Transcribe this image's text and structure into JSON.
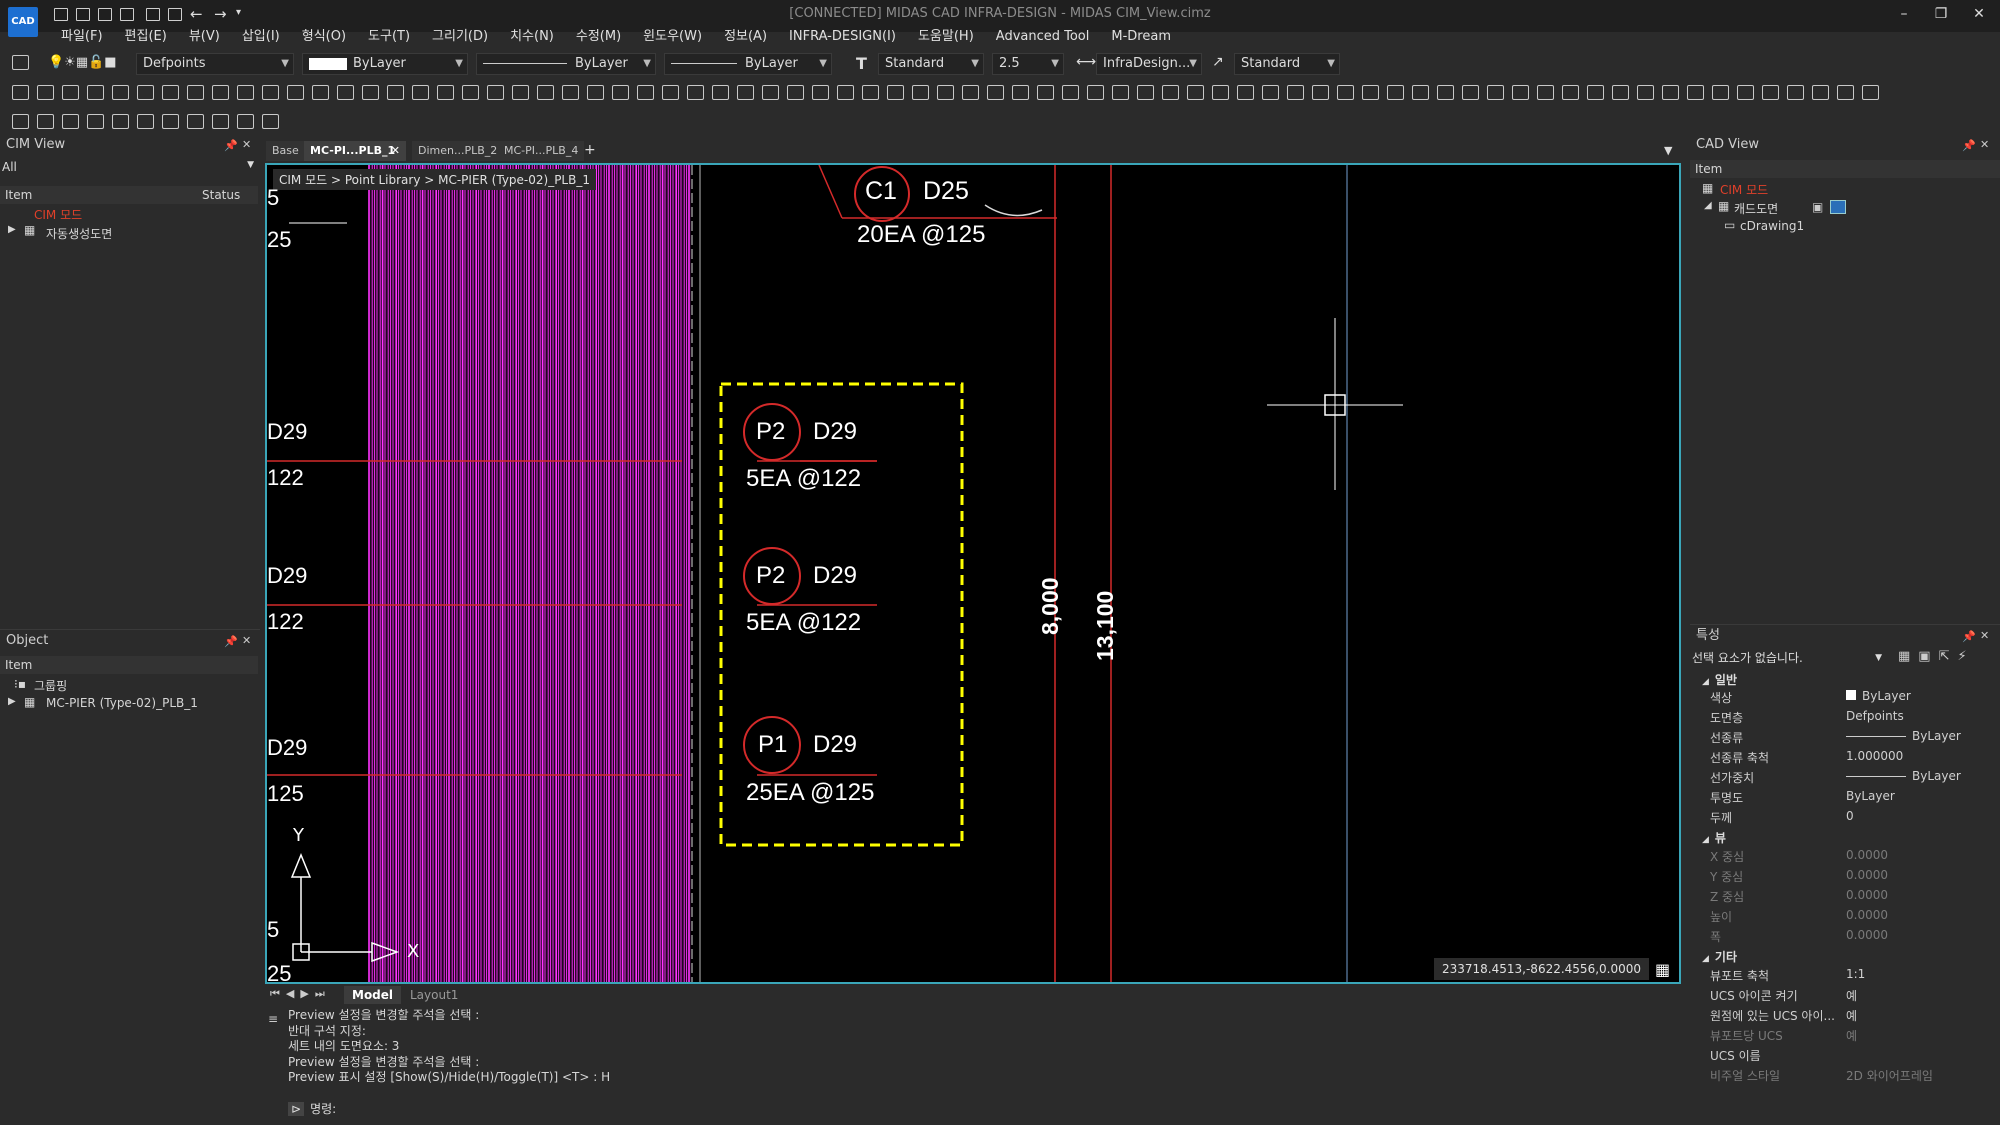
{
  "title_bar": {
    "title": "[CONNECTED] MIDAS CAD INFRA-DESIGN - MIDAS CIM_View.cimz",
    "logo": "CAD"
  },
  "menu": [
    "파일(F)",
    "편집(E)",
    "뷰(V)",
    "삽입(I)",
    "형식(O)",
    "도구(T)",
    "그리기(D)",
    "치수(N)",
    "수정(M)",
    "윈도우(W)",
    "정보(A)",
    "INFRA-DESIGN(I)",
    "도움말(H)",
    "Advanced Tool",
    "M-Dream"
  ],
  "toolbar": {
    "layer": "Defpoints",
    "color": "ByLayer",
    "linetype": "ByLayer",
    "lineweight": "ByLayer",
    "text_style": "Standard",
    "text_height": "2.5",
    "dim_style": "InfraDesign...",
    "multileader_style": "Standard"
  },
  "cim_view": {
    "title": "CIM View",
    "filter": "All",
    "col_item": "Item",
    "col_status": "Status",
    "items": [
      {
        "label": "CIM 모드"
      },
      {
        "label": "자동생성도면"
      }
    ]
  },
  "object_panel": {
    "title": "Object",
    "col_item": "Item",
    "items": [
      {
        "label": "그룹핑"
      },
      {
        "label": "MC-PIER (Type-02)_PLB_1"
      }
    ]
  },
  "doc_tabs": [
    {
      "label": "Base"
    },
    {
      "label": "MC-PI...PLB_1"
    },
    {
      "label": "Dimen...PLB_2"
    },
    {
      "label": "MC-PI...PLB_4"
    }
  ],
  "breadcrumb": "CIM 모드 > Point Library > MC-PIER (Type-02)_PLB_1",
  "drawing": {
    "c1_tag": "C1",
    "c1_bar": "D25",
    "c1_qty": "20EA @125",
    "p2a_tag": "P2",
    "p2a_bar": "D29",
    "p2a_qty": "5EA @122",
    "p2b_tag": "P2",
    "p2b_bar": "D29",
    "p2b_qty": "5EA @122",
    "p1_tag": "P1",
    "p1_bar": "D29",
    "p1_qty": "25EA @125",
    "left_labels": [
      "5",
      "25",
      "D29",
      "122",
      "D29",
      "122",
      "D29",
      "125",
      "5",
      "25"
    ],
    "dim1": "8,000",
    "dim2": "13,100",
    "ucs_x": "X",
    "ucs_y": "Y"
  },
  "coords": "233718.4513,-8622.4556,0.0000",
  "layout_tabs": {
    "model": "Model",
    "layout1": "Layout1"
  },
  "command_history": [
    "Preview 설정을 변경할 주석을 선택 :",
    "반대 구석 지정:",
    "세트 내의 도면요소: 3",
    "Preview 설정을 변경할 주석을 선택 :",
    "Preview 표시 설정 [Show(S)/Hide(H)/Toggle(T)] <T> : H"
  ],
  "command_prompt": "명령:",
  "cad_view": {
    "title": "CAD View",
    "col_item": "Item",
    "items": [
      {
        "label": "CIM 모드"
      },
      {
        "label": "캐드도면"
      },
      {
        "label": "cDrawing1"
      }
    ]
  },
  "properties": {
    "title": "특성",
    "selection": "선택 요소가 없습니다.",
    "general_header": "일반",
    "general": [
      {
        "k": "색상",
        "v": "ByLayer"
      },
      {
        "k": "도면층",
        "v": "Defpoints"
      },
      {
        "k": "선종류",
        "v": "ByLayer"
      },
      {
        "k": "선종류 축척",
        "v": "1.000000"
      },
      {
        "k": "선가중치",
        "v": "ByLayer"
      },
      {
        "k": "투명도",
        "v": "ByLayer"
      },
      {
        "k": "두께",
        "v": "0"
      }
    ],
    "view_header": "뷰",
    "view": [
      {
        "k": "X 중심",
        "v": "0.0000"
      },
      {
        "k": "Y 중심",
        "v": "0.0000"
      },
      {
        "k": "Z 중심",
        "v": "0.0000"
      },
      {
        "k": "높이",
        "v": "0.0000"
      },
      {
        "k": "폭",
        "v": "0.0000"
      }
    ],
    "etc_header": "기타",
    "etc": [
      {
        "k": "뷰포트 축척",
        "v": "1:1"
      },
      {
        "k": "UCS 아이콘 켜기",
        "v": "예"
      },
      {
        "k": "원점에 있는 UCS 아이...",
        "v": "예"
      },
      {
        "k": "뷰포트당 UCS",
        "v": "예"
      },
      {
        "k": "UCS 이름",
        "v": ""
      },
      {
        "k": "비주얼 스타일",
        "v": "2D 와이어프레임"
      }
    ]
  },
  "colors": {
    "accent": "#3aa6b9",
    "magenta": "#ff33ff",
    "red": "#e0402a",
    "yellow": "#ffff00"
  }
}
